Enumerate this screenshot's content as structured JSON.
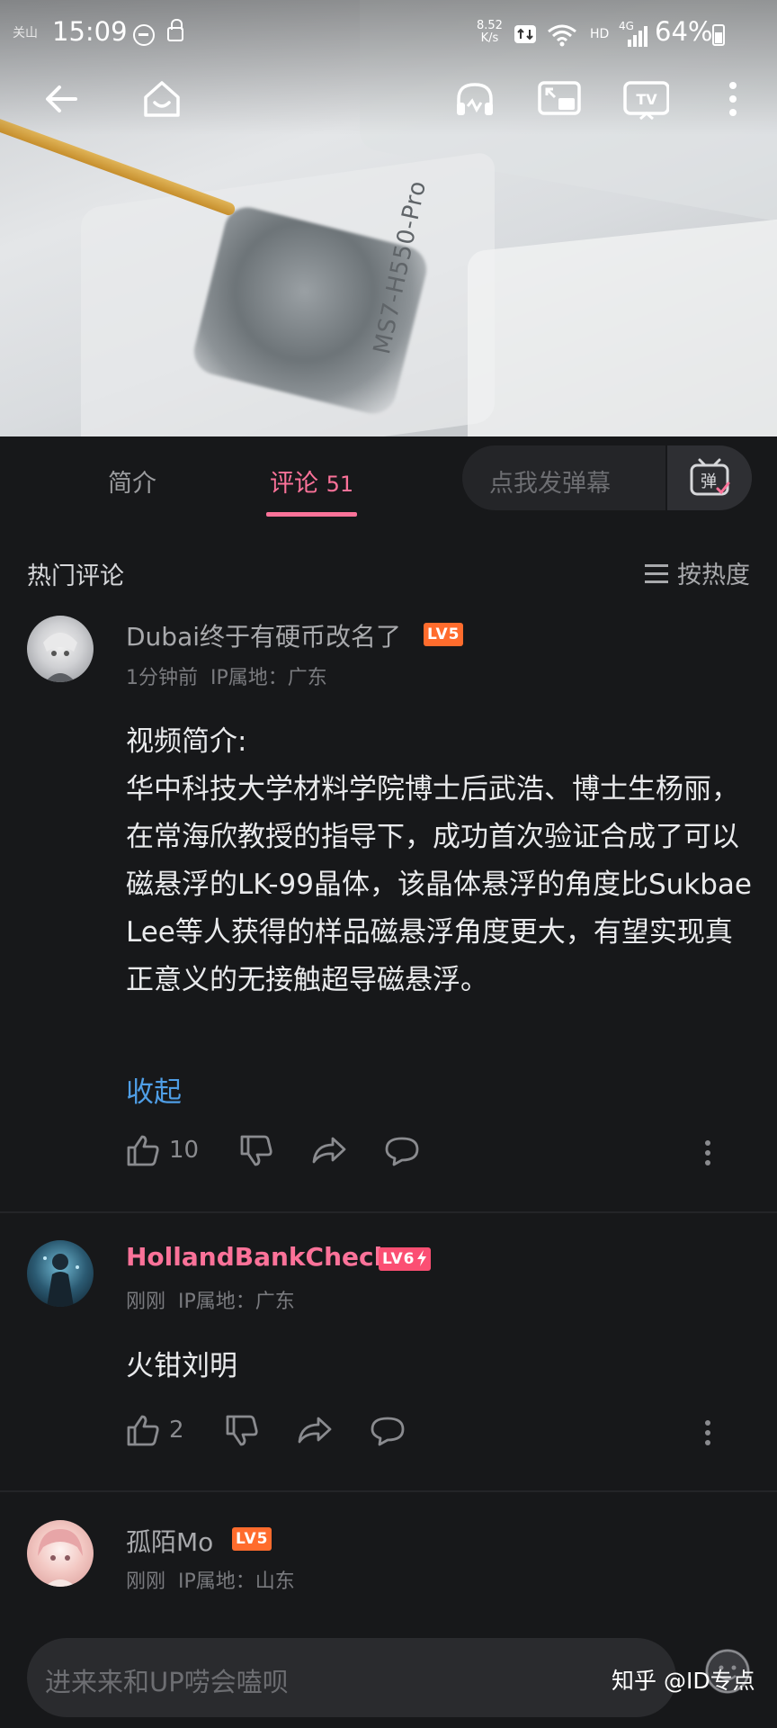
{
  "status_bar": {
    "carrier": "关山",
    "time": "15:09",
    "net_speed_value": "8.52",
    "net_speed_unit": "K/s",
    "hd": "HD",
    "network": "4G",
    "battery": "64%"
  },
  "video": {
    "print_text": "MS7-H550-Pro"
  },
  "tabs": {
    "intro": "简介",
    "comments": "评论",
    "comments_count": "51",
    "danmaku_placeholder": "点我发弹幕",
    "danmaku_button": "弹"
  },
  "section": {
    "title": "热门评论",
    "sort_label": "按热度"
  },
  "comments": [
    {
      "username": "Dubai终于有硬币改名了",
      "level": "LV5",
      "time": "1分钟前",
      "ip": "IP属地：广东",
      "text": "视频简介:\n华中科技大学材料学院博士后武浩、博士生杨丽，在常海欣教授的指导下，成功首次验证合成了可以磁悬浮的LK-99晶体，该晶体悬浮的角度比Sukbae Lee等人获得的样品磁悬浮角度更大，有望实现真正意义的无接触超导磁悬浮。",
      "collapse": "收起",
      "likes": "10"
    },
    {
      "username": "HollandBankCheck",
      "level": "LV6",
      "time": "刚刚",
      "ip": "IP属地：广东",
      "text": "火钳刘明",
      "likes": "2"
    },
    {
      "username": "孤陌Mo",
      "level": "LV5",
      "time": "刚刚",
      "ip": "IP属地：山东"
    }
  ],
  "bottom": {
    "reply_placeholder": "进来来和UP唠会嗑呗",
    "watermark": "知乎 @ID专点"
  },
  "colors": {
    "background": "#17181a",
    "accent_pink": "#fb7299",
    "link_blue": "#4f9ee6",
    "level_orange": "#ff6c2d"
  }
}
